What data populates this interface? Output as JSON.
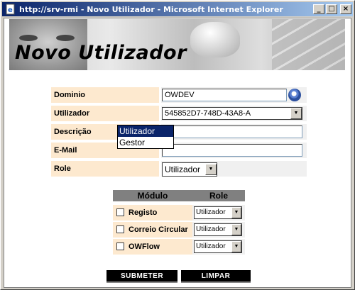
{
  "window": {
    "title": "http://srv-rmi - Novo Utilizador - Microsoft Internet Explorer",
    "controls": {
      "minimize": "_",
      "maximize": "□",
      "close": "×"
    }
  },
  "banner": {
    "heading": "Novo Utilizador"
  },
  "form": {
    "dominio": {
      "label": "Dominio",
      "value": "OWDEV"
    },
    "utilizador": {
      "label": "Utilizador",
      "value": "545852D7-748D-43A8-A"
    },
    "descricao": {
      "label": "Descrição",
      "value": ""
    },
    "email": {
      "label": "E-Mail",
      "value": ""
    },
    "role": {
      "label": "Role",
      "value": "Utilizador",
      "options": [
        "Utilizador",
        "Gestor"
      ],
      "highlighted": "Utilizador"
    }
  },
  "modules": {
    "header_module": "Módulo",
    "header_role": "Role",
    "rows": [
      {
        "name": "Registo",
        "role": "Utilizador",
        "checked": false
      },
      {
        "name": "Correio Circular",
        "role": "Utilizador",
        "checked": false
      },
      {
        "name": "OWFlow",
        "role": "Utilizador",
        "checked": false
      }
    ]
  },
  "buttons": {
    "submit": "SUBMETER",
    "clear": "LIMPAR"
  },
  "icons": {
    "browser": "ie-page-icon",
    "search": "magnifier-icon",
    "dropdown": "chevron-down-icon"
  }
}
